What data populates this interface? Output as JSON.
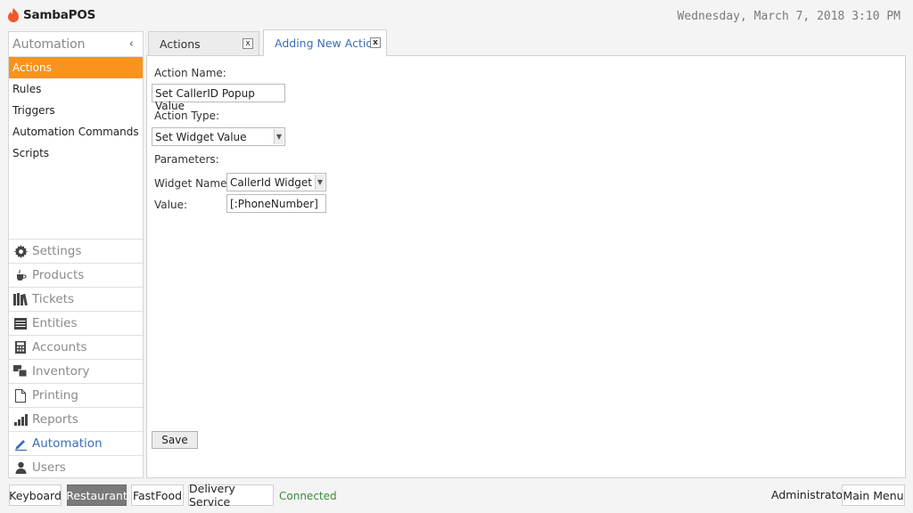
{
  "app": {
    "name": "SambaPOS",
    "datetime": "Wednesday, March 7, 2018 3:10 PM"
  },
  "sidebar": {
    "header": "Automation",
    "collapse_glyph": "‹",
    "items": [
      {
        "label": "Actions",
        "active": true
      },
      {
        "label": "Rules"
      },
      {
        "label": "Triggers"
      },
      {
        "label": "Automation Commands"
      },
      {
        "label": "Scripts"
      }
    ],
    "nav": [
      {
        "label": "Settings",
        "icon": "gear-icon"
      },
      {
        "label": "Products",
        "icon": "coffee-cup-icon"
      },
      {
        "label": "Tickets",
        "icon": "books-icon"
      },
      {
        "label": "Entities",
        "icon": "table-icon"
      },
      {
        "label": "Accounts",
        "icon": "calculator-icon"
      },
      {
        "label": "Inventory",
        "icon": "inventory-icon"
      },
      {
        "label": "Printing",
        "icon": "document-icon"
      },
      {
        "label": "Reports",
        "icon": "bar-chart-icon"
      },
      {
        "label": "Automation",
        "icon": "pen-icon",
        "active": true
      },
      {
        "label": "Users",
        "icon": "user-icon"
      }
    ]
  },
  "tabs": [
    {
      "label": "Actions",
      "close": "x"
    },
    {
      "label": "Adding New Action",
      "close": "x"
    }
  ],
  "form": {
    "action_name_label": "Action Name:",
    "action_name_value": "Set CallerID Popup Value",
    "action_type_label": "Action Type:",
    "action_type_value": "Set Widget Value",
    "parameters_label": "Parameters:",
    "widget_name_label": "Widget Name:",
    "widget_name_value": "CallerId Widget",
    "value_label": "Value:",
    "value_value": "[:PhoneNumber]",
    "save_label": "Save"
  },
  "bottom": {
    "buttons": [
      "Keyboard",
      "Restaurant",
      "FastFood",
      "Delivery Service"
    ],
    "active_button": "Restaurant",
    "status": "Connected",
    "user": "Administrator",
    "main_menu": "Main Menu"
  },
  "colors": {
    "accent": "#f7931e",
    "link": "#3a6fb5",
    "status_ok": "#3c8c3c"
  }
}
